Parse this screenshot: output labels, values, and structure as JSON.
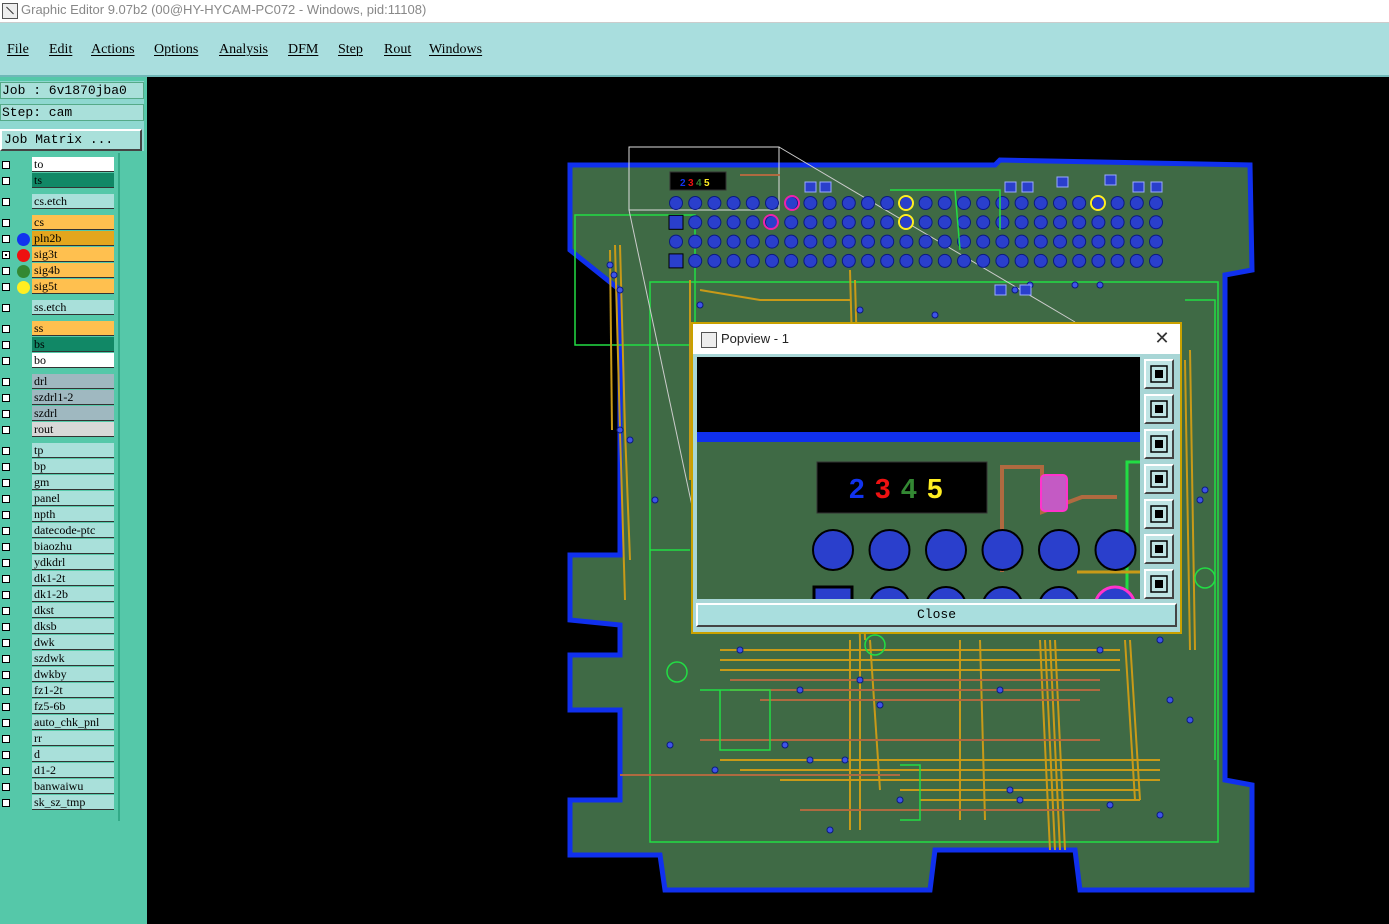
{
  "window": {
    "title": "Graphic Editor 9.07b2 (00@HY-HYCAM-PC072 - Windows, pid:11108)"
  },
  "menu": [
    "File",
    "Edit",
    "Actions",
    "Options",
    "Analysis",
    "DFM",
    "Step",
    "Rout",
    "Windows"
  ],
  "job": {
    "job_line": "Job : 6v1870jba0",
    "step_line": "Step: cam",
    "matrix_button": "Job Matrix ..."
  },
  "layers": [
    {
      "name": "to",
      "color": "#ffffff",
      "dot": null,
      "checked": false
    },
    {
      "name": "ts",
      "color": "#118866",
      "dot": null,
      "checked": false
    },
    {
      "name": "cs.etch",
      "color": "#a9e0da",
      "dot": null,
      "checked": false
    },
    {
      "name": "cs",
      "color": "#ffc04f",
      "dot": null,
      "checked": false
    },
    {
      "name": "pln2b",
      "color": "#e4a61e",
      "dot": "#1133ee",
      "checked": false
    },
    {
      "name": "sig3t",
      "color": "#ffc04f",
      "dot": "#ee1111",
      "checked": true
    },
    {
      "name": "sig4b",
      "color": "#ffc04f",
      "dot": "#338833",
      "checked": false
    },
    {
      "name": "sig5t",
      "color": "#ffc04f",
      "dot": "#ffee22",
      "checked": false
    },
    {
      "name": "ss.etch",
      "color": "#a9e0da",
      "dot": null,
      "checked": false
    },
    {
      "name": "ss",
      "color": "#ffc04f",
      "dot": null,
      "checked": false
    },
    {
      "name": "bs",
      "color": "#118866",
      "dot": null,
      "checked": false
    },
    {
      "name": "bo",
      "color": "#ffffff",
      "dot": null,
      "checked": false
    },
    {
      "name": "drl",
      "color": "#9fb8c0",
      "dot": null,
      "checked": false
    },
    {
      "name": "szdrl1-2",
      "color": "#9fb8c0",
      "dot": null,
      "checked": false
    },
    {
      "name": "szdrl",
      "color": "#9fb8c0",
      "dot": null,
      "checked": false
    },
    {
      "name": "rout",
      "color": "#d8d8d8",
      "dot": null,
      "checked": false
    },
    {
      "name": "tp",
      "color": "#a9e0da",
      "dot": null,
      "checked": false
    },
    {
      "name": "bp",
      "color": "#a9e0da",
      "dot": null,
      "checked": false
    },
    {
      "name": "gm",
      "color": "#a9e0da",
      "dot": null,
      "checked": false
    },
    {
      "name": "panel",
      "color": "#a9e0da",
      "dot": null,
      "checked": false
    },
    {
      "name": "npth",
      "color": "#a9e0da",
      "dot": null,
      "checked": false
    },
    {
      "name": "datecode-ptc",
      "color": "#a9e0da",
      "dot": null,
      "checked": false
    },
    {
      "name": "biaozhu",
      "color": "#a9e0da",
      "dot": null,
      "checked": false
    },
    {
      "name": "ydkdrl",
      "color": "#a9e0da",
      "dot": null,
      "checked": false
    },
    {
      "name": "dk1-2t",
      "color": "#a9e0da",
      "dot": null,
      "checked": false
    },
    {
      "name": "dk1-2b",
      "color": "#a9e0da",
      "dot": null,
      "checked": false
    },
    {
      "name": "dkst",
      "color": "#a9e0da",
      "dot": null,
      "checked": false
    },
    {
      "name": "dksb",
      "color": "#a9e0da",
      "dot": null,
      "checked": false
    },
    {
      "name": "dwk",
      "color": "#a9e0da",
      "dot": null,
      "checked": false
    },
    {
      "name": "szdwk",
      "color": "#a9e0da",
      "dot": null,
      "checked": false
    },
    {
      "name": "dwkby",
      "color": "#a9e0da",
      "dot": null,
      "checked": false
    },
    {
      "name": "fz1-2t",
      "color": "#a9e0da",
      "dot": null,
      "checked": false
    },
    {
      "name": "fz5-6b",
      "color": "#a9e0da",
      "dot": null,
      "checked": false
    },
    {
      "name": "auto_chk_pnl",
      "color": "#a9e0da",
      "dot": null,
      "checked": false
    },
    {
      "name": "rr",
      "color": "#a9e0da",
      "dot": null,
      "checked": false
    },
    {
      "name": "d",
      "color": "#a9e0da",
      "dot": null,
      "checked": false
    },
    {
      "name": "d1-2",
      "color": "#a9e0da",
      "dot": null,
      "checked": false
    },
    {
      "name": "banwaiwu",
      "color": "#a9e0da",
      "dot": null,
      "checked": false
    },
    {
      "name": "sk_sz_tmp",
      "color": "#a9e0da",
      "dot": null,
      "checked": false
    }
  ],
  "board": {
    "marker_digits": [
      "2",
      "3",
      "4",
      "5"
    ],
    "marker_colors": [
      "#1133ee",
      "#ee1111",
      "#338833",
      "#ffee22"
    ]
  },
  "popview": {
    "title": "Popview - 1",
    "close_label": "Close",
    "tools": [
      "fit-icon",
      "pan-up-icon",
      "pan-down-icon",
      "pan-left-icon",
      "pan-right-icon",
      "zoom-in-icon",
      "zoom-out-icon"
    ]
  }
}
